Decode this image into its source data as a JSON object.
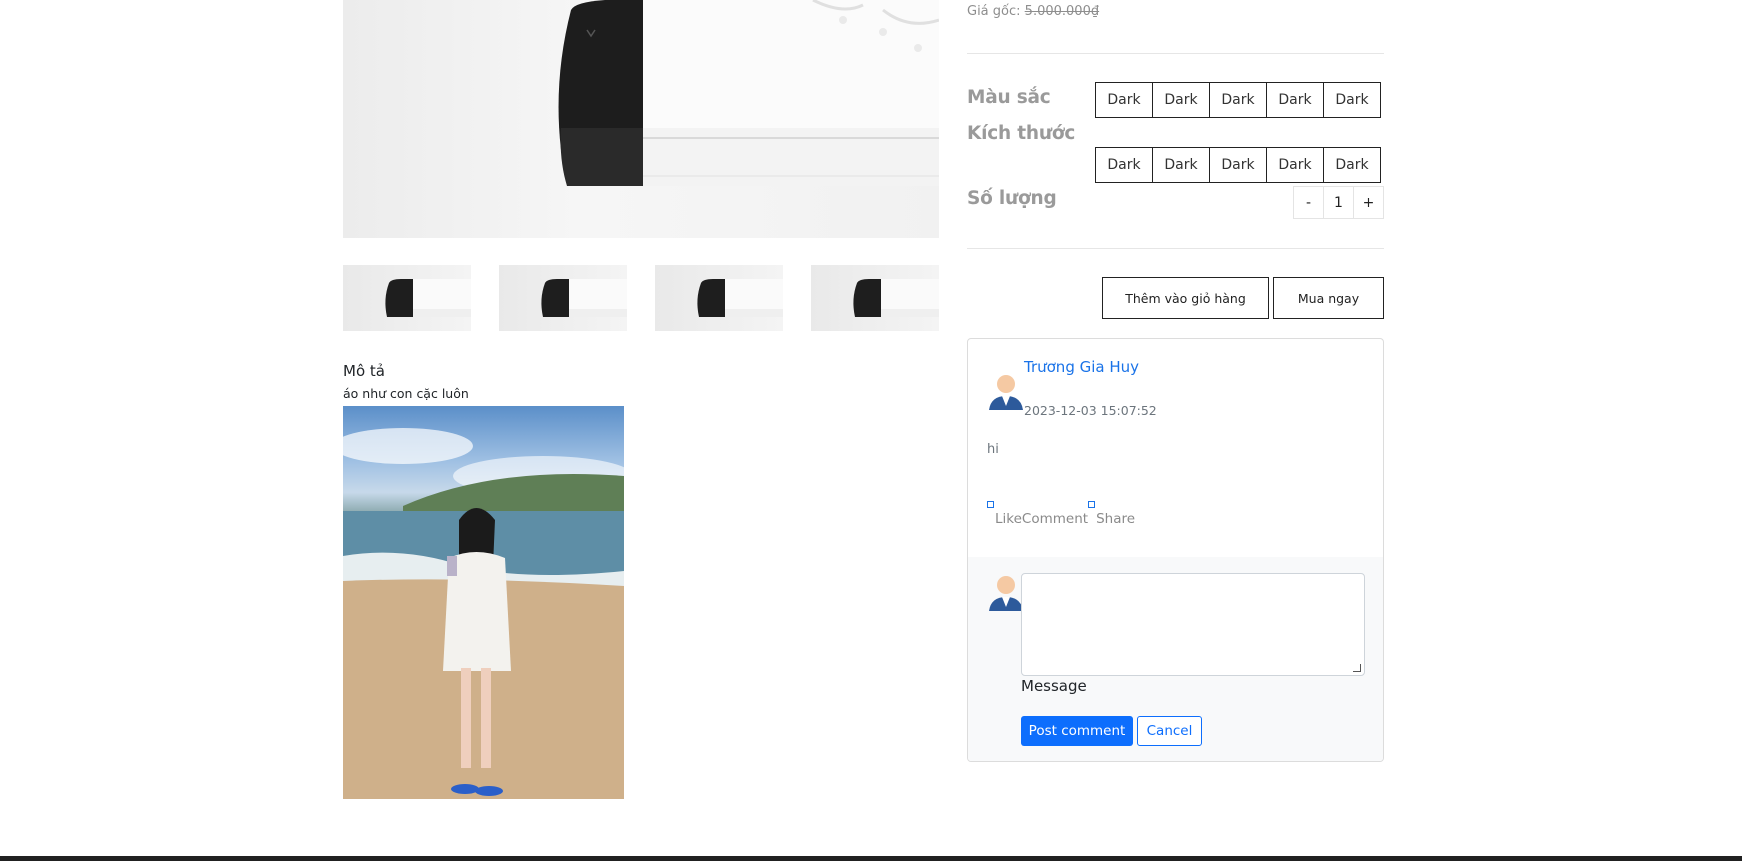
{
  "product": {
    "original_price_label": "Giá gốc:",
    "original_price_value": "5.000.000₫",
    "color_label": "Màu sắc",
    "size_label": "Kích thước",
    "quantity_label": "Số lượng",
    "color_options": [
      "Dark",
      "Dark",
      "Dark",
      "Dark",
      "Dark"
    ],
    "size_options": [
      "Dark",
      "Dark",
      "Dark",
      "Dark",
      "Dark"
    ],
    "quantity": {
      "minus": "-",
      "value": "1",
      "plus": "+"
    },
    "add_to_cart_label": "Thêm vào giỏ hàng",
    "buy_now_label": "Mua ngay"
  },
  "description": {
    "heading": "Mô tả",
    "text": "áo như con cặc luôn"
  },
  "comments": {
    "items": [
      {
        "author": "Trương Gia Huy",
        "timestamp": "2023-12-03 15:07:52",
        "body": "hi",
        "like_label": "Like",
        "comment_label": "Comment",
        "share_label": "Share"
      }
    ],
    "form": {
      "textarea_value": "",
      "message_label": "Message",
      "post_label": "Post comment",
      "cancel_label": "Cancel"
    }
  },
  "colors": {
    "accent": "#0d6efd",
    "author_link": "#1a73e8",
    "muted_label": "#9a9a9a",
    "footer": "#212121"
  },
  "icons": [
    "sneaker-image",
    "user-avatar-icon",
    "like-icon",
    "share-icon",
    "resize-handle-icon"
  ]
}
